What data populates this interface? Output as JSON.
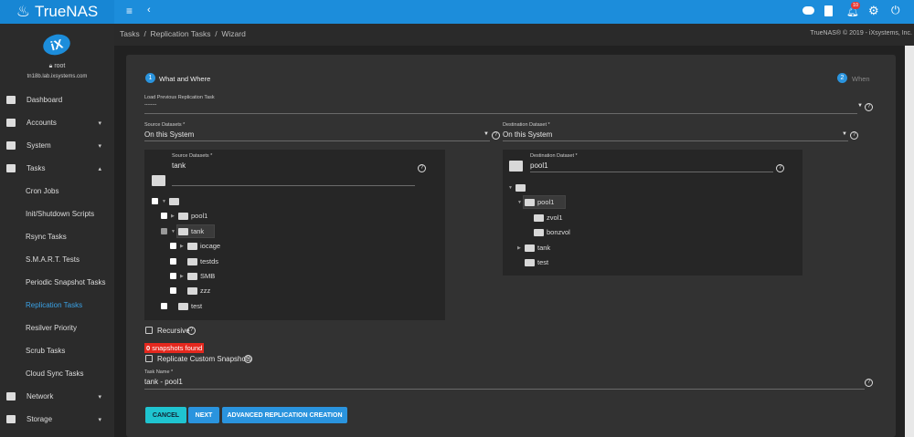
{
  "app": {
    "name": "TrueNAS",
    "copyright": "TrueNAS® © 2019 - iXsystems, Inc.",
    "notifications": "10"
  },
  "user": {
    "name": "root",
    "host": "tn18b.lab.ixsystems.com",
    "logo": "iX"
  },
  "breadcrumb": [
    "Tasks",
    "Replication Tasks",
    "Wizard"
  ],
  "sidebar": [
    {
      "label": "Dashboard",
      "icon": "dashboard-icon"
    },
    {
      "label": "Accounts",
      "icon": "people-icon",
      "chevron": "▾"
    },
    {
      "label": "System",
      "icon": "laptop-icon",
      "chevron": "▾"
    },
    {
      "label": "Tasks",
      "icon": "calendar-icon",
      "chevron": "▴"
    },
    {
      "label": "Cron Jobs",
      "sub": true
    },
    {
      "label": "Init/Shutdown Scripts",
      "sub": true
    },
    {
      "label": "Rsync Tasks",
      "sub": true
    },
    {
      "label": "S.M.A.R.T. Tests",
      "sub": true
    },
    {
      "label": "Periodic Snapshot Tasks",
      "sub": true
    },
    {
      "label": "Replication Tasks",
      "sub": true,
      "active": true
    },
    {
      "label": "Resilver Priority",
      "sub": true
    },
    {
      "label": "Scrub Tasks",
      "sub": true
    },
    {
      "label": "Cloud Sync Tasks",
      "sub": true
    },
    {
      "label": "Network",
      "icon": "network-icon",
      "chevron": "▾"
    },
    {
      "label": "Storage",
      "icon": "storage-icon",
      "chevron": "▾"
    }
  ],
  "wizard": {
    "steps": [
      {
        "num": "1",
        "label": "What and Where"
      },
      {
        "num": "2",
        "label": "When"
      }
    ],
    "load_previous": {
      "label": "Load Previous Replication Task",
      "value": "--------"
    },
    "source": {
      "label": "Source Datasets *",
      "value": "On this System"
    },
    "destination": {
      "label": "Destination Dataset *",
      "value": "On this System"
    },
    "source_tree": {
      "label": "Source Datasets *",
      "value": "tank",
      "nodes": [
        {
          "name": "",
          "depth": 0,
          "tri": "▼",
          "checked": false
        },
        {
          "name": "pool1",
          "depth": 1,
          "tri": "▶",
          "checked": false
        },
        {
          "name": "tank",
          "depth": 1,
          "tri": "▼",
          "checked": true,
          "selected": true
        },
        {
          "name": "iocage",
          "depth": 2,
          "tri": "▶",
          "checked": false
        },
        {
          "name": "testds",
          "depth": 2,
          "tri": "",
          "checked": false
        },
        {
          "name": "SMB",
          "depth": 2,
          "tri": "▶",
          "checked": false
        },
        {
          "name": "zzz",
          "depth": 2,
          "tri": "",
          "checked": false
        },
        {
          "name": "test",
          "depth": 1,
          "tri": "",
          "checked": false
        }
      ]
    },
    "dest_tree": {
      "label": "Destination Dataset *",
      "value": "pool1",
      "nodes": [
        {
          "name": "",
          "depth": 0,
          "tri": "▼"
        },
        {
          "name": "pool1",
          "depth": 1,
          "tri": "▼",
          "selected": true
        },
        {
          "name": "zvol1",
          "depth": 2,
          "tri": ""
        },
        {
          "name": "bonzvol",
          "depth": 2,
          "tri": ""
        },
        {
          "name": "tank",
          "depth": 1,
          "tri": "▶"
        },
        {
          "name": "test",
          "depth": 1,
          "tri": ""
        }
      ]
    },
    "recursive": "Recursive",
    "snapshots_count": "0",
    "snapshots_text": "snapshots found",
    "replicate_custom": "Replicate Custom Snapshots",
    "task_name": {
      "label": "Task Name *",
      "value": "tank - pool1"
    },
    "buttons": {
      "cancel": "CANCEL",
      "next": "NEXT",
      "advanced": "ADVANCED REPLICATION CREATION"
    }
  },
  "colors": {
    "topbar": "#1c8ddb",
    "accent": "#2a94de",
    "cancel": "#1fc4d0",
    "error": "#e5281e"
  }
}
